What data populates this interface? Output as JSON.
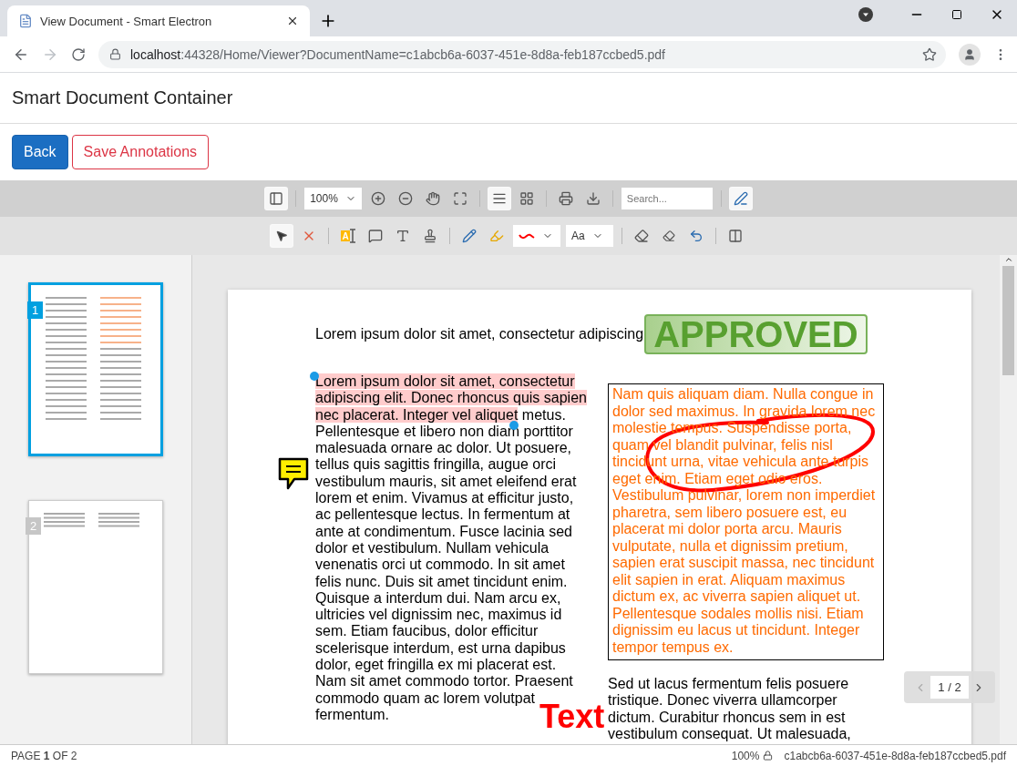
{
  "browser": {
    "tab_title": "View Document - Smart Electron",
    "url_host": "localhost",
    "url_rest": ":44328/Home/Viewer?DocumentName=c1abcb6a-6037-451e-8d8a-feb187ccbed5.pdf"
  },
  "app": {
    "title": "Smart Document Container"
  },
  "buttons": [
    {
      "label": "Back",
      "kind": "primary"
    },
    {
      "label": "Save Annotations",
      "kind": "outline"
    }
  ],
  "main_toolbar": [
    {
      "kind": "button",
      "selected": true
    },
    {
      "kind": "divider"
    },
    {
      "kind": "select",
      "value": "100%"
    },
    {
      "kind": "button",
      "selected": false
    },
    {
      "kind": "button",
      "selected": false
    },
    {
      "kind": "button",
      "selected": false
    },
    {
      "kind": "button",
      "selected": false
    },
    {
      "kind": "divider"
    },
    {
      "kind": "button",
      "selected": true
    },
    {
      "kind": "button",
      "selected": false
    },
    {
      "kind": "divider"
    },
    {
      "kind": "button",
      "selected": false
    },
    {
      "kind": "button",
      "selected": false
    },
    {
      "kind": "divider"
    },
    {
      "kind": "search",
      "placeholder": "Search..."
    },
    {
      "kind": "divider"
    },
    {
      "kind": "button",
      "selected": true
    }
  ],
  "annotation_toolbar": [
    {
      "kind": "button",
      "selected": true
    },
    {
      "kind": "button",
      "selected": false
    },
    {
      "kind": "divider"
    },
    {
      "kind": "button",
      "selected": false,
      "label": "A"
    },
    {
      "kind": "button",
      "selected": false
    },
    {
      "kind": "button",
      "selected": false
    },
    {
      "kind": "button",
      "selected": false
    },
    {
      "kind": "divider"
    },
    {
      "kind": "button",
      "selected": false
    },
    {
      "kind": "button",
      "selected": false
    },
    {
      "kind": "select"
    },
    {
      "kind": "select",
      "value": "Aa"
    },
    {
      "kind": "divider"
    },
    {
      "kind": "button",
      "selected": false
    },
    {
      "kind": "button",
      "selected": false
    },
    {
      "kind": "button",
      "selected": false
    },
    {
      "kind": "divider"
    },
    {
      "kind": "button",
      "selected": false
    }
  ],
  "thumbnails": [
    {
      "number": "1",
      "selected": true
    },
    {
      "number": "2",
      "selected": false
    }
  ],
  "page": {
    "header": "Lorem ipsum dolor sit amet, consectetur adipiscing",
    "stamp": "APPROVED",
    "left_paragraph": {
      "highlighted": "Lorem ipsum dolor sit amet, consectetur adipiscing elit. Donec rhoncus quis sapien nec placerat. Integer vel aliquet",
      "rest": " metus. Pellentesque et libero non diam porttitor malesuada ornare ac dolor. Ut posuere, tellus quis sagittis fringilla, augue orci vestibulum mauris, sit amet eleifend erat lorem et enim. Vivamus at efficitur justo, ac pellentesque lectus. In fermentum at ante at condimentum. Fusce lacinia sed dolor et vestibulum. Nullam vehicula venenatis orci ut commodo. In sit amet felis nunc. Duis sit amet tincidunt enim. Quisque a interdum dui. Nam arcu ex, ultricies vel dignissim nec, maximus id sem. Etiam faucibus, dolor efficitur scelerisque interdum, est urna dapibus dolor, eget fringilla ex mi placerat est. Nam sit amet commodo tortor. Praesent commodo quam ac lorem volutpat fermentum."
    },
    "box_text": "Nam quis aliquam diam. Nulla congue in dolor sed maximus. In gravida lorem nec molestie tempus. Suspendisse porta, quam vel blandit pulvinar, felis nisl tincidunt urna, vitae vehicula ante turpis eget enim. Etiam eget odio eros. Vestibulum pulvinar, lorem non imperdiet pharetra, sem libero posuere est, eu placerat mi dolor porta arcu. Mauris vulputate, nulla et dignissim pretium, sapien erat suscipit massa, nec tincidunt elit sapien in erat. Aliquam maximus dictum ex, ac viverra sapien aliquet ut. Pellentesque sodales mollis nisi. Etiam dignissim eu lacus ut tincidunt. Integer tempor tempus ex.",
    "right_paragraph": "Sed ut lacus fermentum felis posuere tristique. Donec viverra ullamcorper dictum. Curabitur rhoncus sem in est vestibulum consequat. Ut malesuada,",
    "free_text": "Text"
  },
  "page_nav": "1 / 2",
  "status_bar": {
    "page": "PAGE **1** OF 2",
    "zoom": "100%",
    "file": "c1abcb6a-6037-451e-8d8a-feb187ccbed5.pdf"
  }
}
